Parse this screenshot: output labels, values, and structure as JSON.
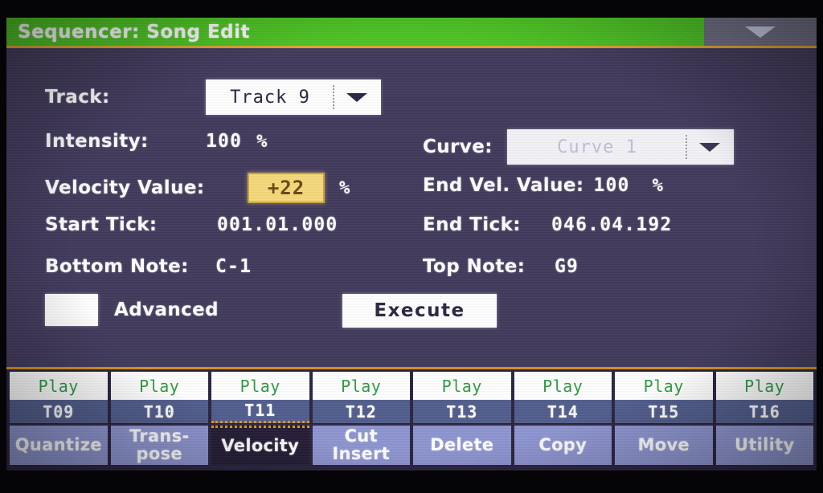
{
  "titlebar": {
    "title": "Sequencer: Song Edit",
    "menu_icon": "chevron-down-icon"
  },
  "colors": {
    "title_bar": "#4ec424",
    "title_underline": "#e0a828",
    "screen_bg": "#423a5c",
    "highlight_box": "#f5d97a",
    "highlight_text": "#6b4a14",
    "track_band": "#515d8c",
    "tab_bar": "#8e95d0",
    "tab_selected": "#241d36",
    "play_text": "#2e9c42",
    "marker": "#e2941c"
  },
  "form": {
    "track": {
      "label": "Track:",
      "value": "Track 9",
      "arrow_icon": "chevron-down-icon"
    },
    "intensity": {
      "label": "Intensity:",
      "value": "100",
      "unit": "%"
    },
    "curve": {
      "label": "Curve:",
      "value": "Curve 1",
      "arrow_icon": "chevron-down-icon",
      "disabled": true
    },
    "velocity_value": {
      "label": "Velocity Value:",
      "value": "+22",
      "unit": "%",
      "selected": true
    },
    "end_vel_value": {
      "label": "End Vel. Value:",
      "value": "100",
      "unit": "%"
    },
    "start_tick": {
      "label": "Start Tick:",
      "value": "001.01.000"
    },
    "end_tick": {
      "label": "End Tick:",
      "value": "046.04.192"
    },
    "bottom_note": {
      "label": "Bottom Note:",
      "value": "C-1"
    },
    "top_note": {
      "label": "Top Note:",
      "value": "G9"
    },
    "advanced": {
      "label": "Advanced",
      "checked": false
    },
    "execute": {
      "label": "Execute"
    }
  },
  "tracks": [
    {
      "status": "Play",
      "name": "T09",
      "marked": false
    },
    {
      "status": "Play",
      "name": "T10",
      "marked": false
    },
    {
      "status": "Play",
      "name": "T11",
      "marked": true
    },
    {
      "status": "Play",
      "name": "T12",
      "marked": false
    },
    {
      "status": "Play",
      "name": "T13",
      "marked": false
    },
    {
      "status": "Play",
      "name": "T14",
      "marked": false
    },
    {
      "status": "Play",
      "name": "T15",
      "marked": false
    },
    {
      "status": "Play",
      "name": "T16",
      "marked": false
    }
  ],
  "tabs": [
    {
      "label": "Quantize",
      "selected": false
    },
    {
      "label": "Trans-\npose",
      "selected": false
    },
    {
      "label": "Velocity",
      "selected": true
    },
    {
      "label": "Cut\nInsert",
      "selected": false
    },
    {
      "label": "Delete",
      "selected": false
    },
    {
      "label": "Copy",
      "selected": false
    },
    {
      "label": "Move",
      "selected": false
    },
    {
      "label": "Utility",
      "selected": false
    }
  ]
}
